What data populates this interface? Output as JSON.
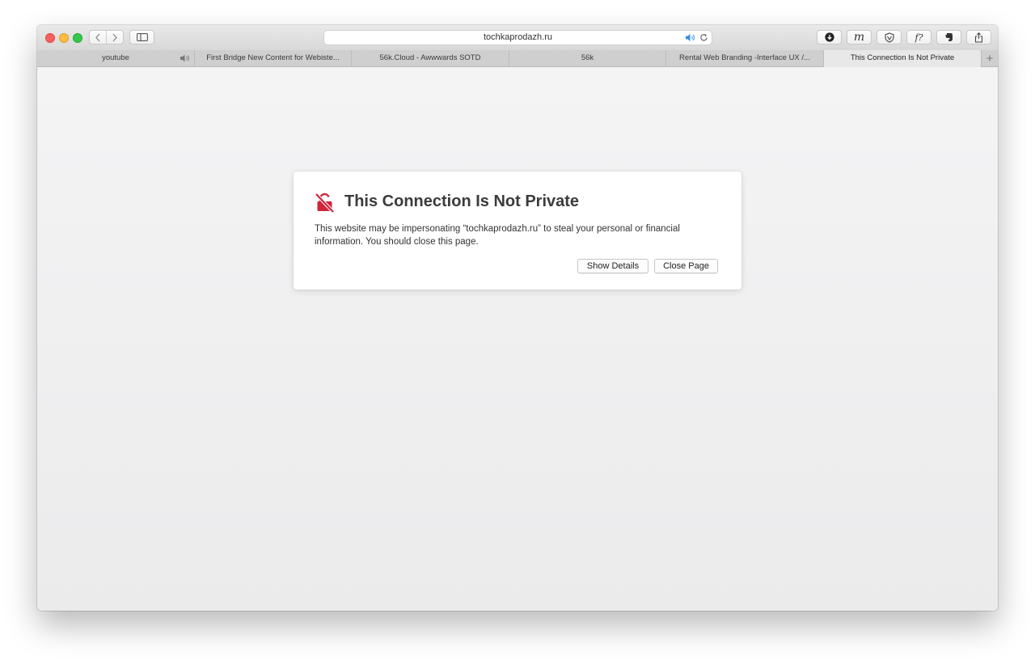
{
  "toolbar": {
    "address": "tochkaprodazh.ru",
    "icons": {
      "back": "chevron-left-icon",
      "forward": "chevron-right-icon",
      "sidebar": "sidebar-icon",
      "speaker": "speaker-icon",
      "reload": "reload-icon",
      "downloads": "download-icon",
      "extension_m": "m-extension-icon",
      "extension_shield": "shield-extension-icon",
      "extension_f": "font-extension-icon",
      "extension_evernote": "evernote-icon",
      "share": "share-icon"
    },
    "extension_m_label": "m",
    "extension_f_label": "f?"
  },
  "tabs": [
    {
      "label": "youtube",
      "active": false,
      "audio": true
    },
    {
      "label": "First Bridge New Content for Webiste...",
      "active": false,
      "audio": false
    },
    {
      "label": "56k.Cloud - Awwwards SOTD",
      "active": false,
      "audio": false
    },
    {
      "label": "56k",
      "active": false,
      "audio": false
    },
    {
      "label": "Rental Web Branding -Interface UX /...",
      "active": false,
      "audio": false
    },
    {
      "label": "This Connection Is Not Private",
      "active": true,
      "audio": false
    }
  ],
  "new_tab_label": "+",
  "dialog": {
    "icon": "broken-lock-warning-icon",
    "title": "This Connection Is Not Private",
    "body": "This website may be impersonating “tochkaprodazh.ru” to steal your personal or financial information. You should close this page.",
    "show_details_label": "Show Details",
    "close_page_label": "Close Page"
  },
  "colors": {
    "warning": "#d0253b",
    "traffic_close": "#fc605b",
    "traffic_minimize": "#fdbc40",
    "traffic_maximize": "#34c84a",
    "speaker_active": "#3b8ee8"
  }
}
